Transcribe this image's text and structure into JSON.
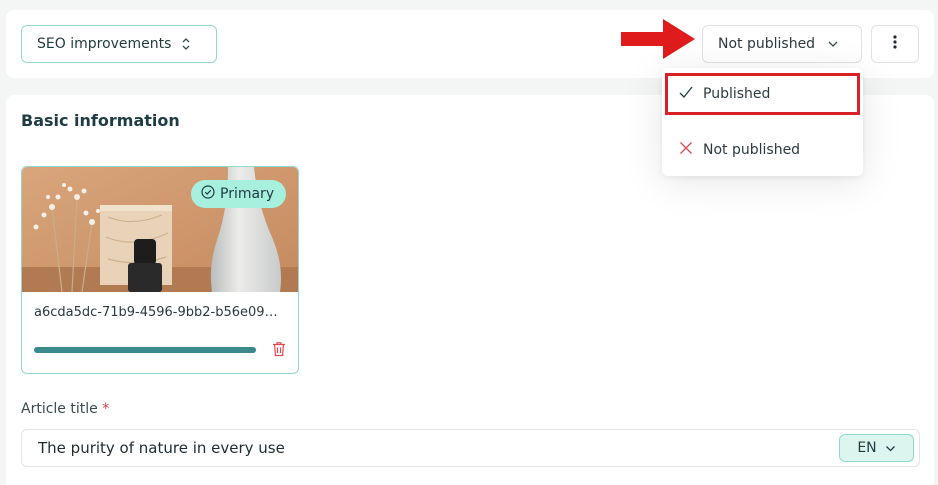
{
  "topbar": {
    "seo_select_label": "SEO improvements",
    "status_select_value": "Not published",
    "more_icon": "kebab-vertical-icon"
  },
  "status_dropdown": {
    "options": [
      {
        "label": "Published",
        "icon": "check-icon",
        "highlighted": true
      },
      {
        "label": "Not published",
        "icon": "x-icon",
        "highlighted": false
      }
    ]
  },
  "basic_info": {
    "title": "Basic information",
    "media": {
      "badge": "Primary",
      "file_name": "a6cda5dc-71b9-4596-9bb2-b56e09…",
      "upload_progress": 1.0
    },
    "article_title": {
      "label": "Article title",
      "required_mark": "*",
      "value": "The purity of nature in every use",
      "language": "EN"
    }
  },
  "colors": {
    "accent_teal": "#3a8a8c",
    "badge_mint": "#a8f0de",
    "highlight_red": "#d92127",
    "arrow_red": "#e01b1b"
  }
}
